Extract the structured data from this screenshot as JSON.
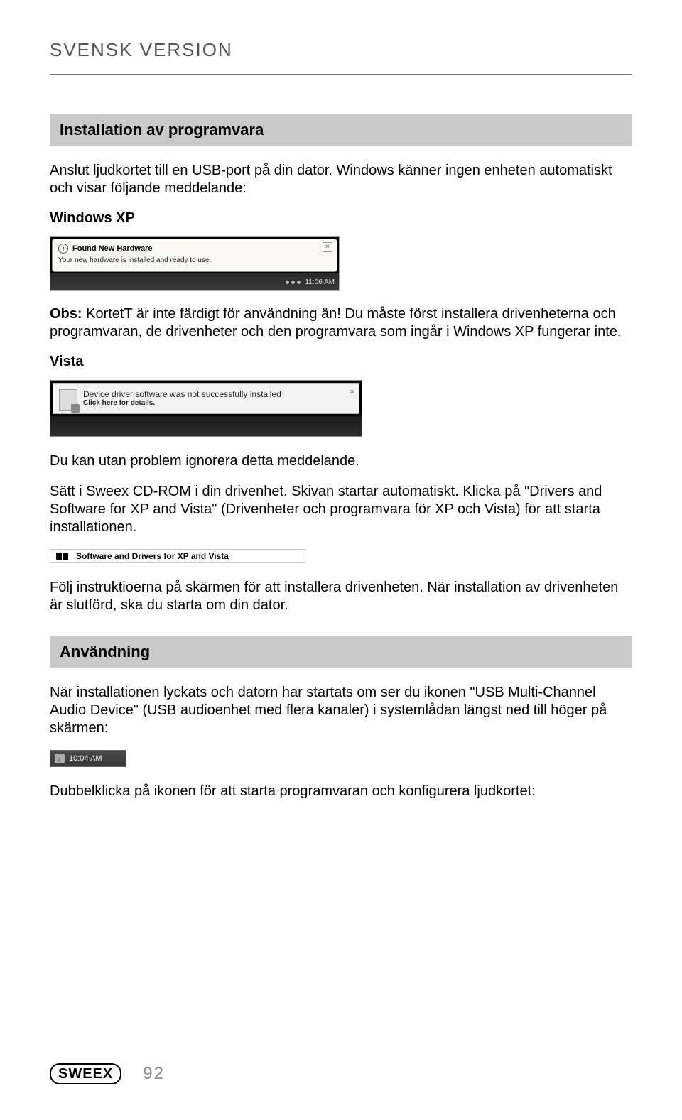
{
  "header": {
    "version_label": "SVENSK VERSION"
  },
  "section1": {
    "title": "Installation av programvara",
    "p1": "Anslut ljudkortet till en USB-port på din dator. Windows känner ingen enheten automatiskt och visar följande meddelande:",
    "xp_head": "Windows XP",
    "xp_bubble": {
      "title": "Found New Hardware",
      "sub": "Your new hardware is installed and ready to use.",
      "clock": "11:06 AM"
    },
    "obs_label": "Obs:",
    "obs_text": " KortetT är inte färdigt för användning än! Du måste först installera drivenheterna och programvaran, de drivenheter och den programvara som ingår i Windows XP fungerar inte.",
    "vista_head": "Vista",
    "vista_bubble": {
      "line1": "Device driver software was not successfully installed",
      "line2": "Click here for details."
    },
    "after_vista": " Du kan utan problem ignorera detta meddelande.",
    "cdrom_para": "Sätt i Sweex CD-ROM i din drivenhet. Skivan startar automatiskt. Klicka på \"Drivers and Software for XP and Vista\" (Drivenheter och programvara för XP och Vista) för att starta installationen.",
    "menu_item_label": "Software and Drivers for XP and Vista",
    "follow_para": "Följ instruktioerna på skärmen för att installera drivenheten. När installation av drivenheten är slutförd, ska du starta om din dator."
  },
  "section2": {
    "title": "Användning",
    "p1": "När installationen lyckats och datorn har startats om ser du ikonen \"USB Multi-Channel Audio Device\" (USB audioenhet med flera kanaler) i systemlådan längst ned till höger på skärmen:",
    "tray_time": "10:04 AM",
    "p2": "Dubbelklicka på ikonen för att starta programvaran och konfigurera ljudkortet:"
  },
  "footer": {
    "logo_text": "SWEEX",
    "page": "92"
  }
}
